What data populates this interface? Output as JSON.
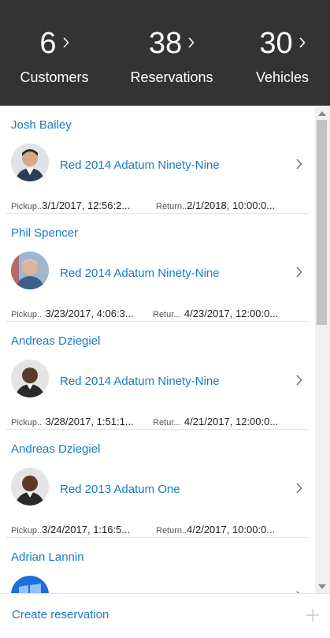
{
  "header": {
    "stats": [
      {
        "count": "6",
        "label": "Customers"
      },
      {
        "count": "38",
        "label": "Reservations"
      },
      {
        "count": "30",
        "label": "Vehicles"
      }
    ],
    "chevron_icon": "chevron-right-icon"
  },
  "reservations": [
    {
      "customer": "Josh Bailey",
      "vehicle": "Red 2014 Adatum Ninety-Nine",
      "pickup_label": "Pickup..",
      "pickup_value": "3/1/2017, 12:56:2...",
      "return_label": "Return..",
      "return_value": "2/1/2018, 10:00:0..."
    },
    {
      "customer": "Phil Spencer",
      "vehicle": "Red 2014 Adatum Ninety-Nine",
      "pickup_label": "Pickup..",
      "pickup_value": "3/23/2017, 4:06:3...",
      "return_label": "Retur...",
      "return_value": "4/23/2017, 12:00:0..."
    },
    {
      "customer": "Andreas Dziegiel",
      "vehicle": "Red 2014 Adatum Ninety-Nine",
      "pickup_label": "Pickup..",
      "pickup_value": "3/28/2017, 1:51:1...",
      "return_label": "Retur...",
      "return_value": "4/21/2017, 12:00:0..."
    },
    {
      "customer": "Andreas Dziegiel",
      "vehicle": "Red 2013 Adatum One",
      "pickup_label": "Pickup..",
      "pickup_value": "3/24/2017, 1:16:5...",
      "return_label": "Return..",
      "return_value": "4/2/2017, 10:00:0..."
    },
    {
      "customer": "Adrian Lannin",
      "vehicle": "",
      "pickup_label": "",
      "pickup_value": "",
      "return_label": "",
      "return_value": ""
    }
  ],
  "footer": {
    "create_label": "Create reservation",
    "add_icon": "plus-icon"
  },
  "colors": {
    "header_bg": "#333333",
    "accent": "#1a7ac4"
  }
}
